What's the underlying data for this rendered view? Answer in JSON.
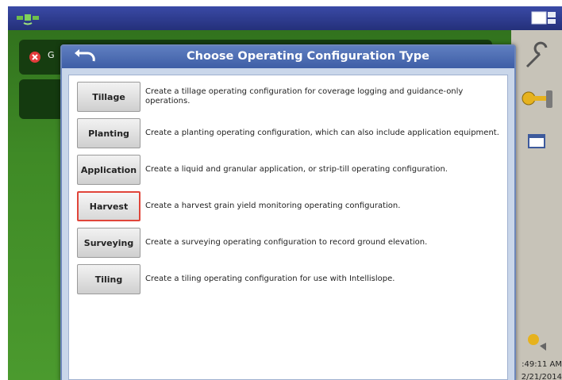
{
  "header": {
    "status_text": "G",
    "icons": {
      "satellite": "satellite-icon",
      "screens": "screens-icon",
      "error": "error-icon"
    }
  },
  "sidebar": {
    "icons": [
      "wrench-icon",
      "key-icon",
      "screen-icon",
      "tools-icon"
    ],
    "time": ":49:11 AM",
    "date": "2/21/2014"
  },
  "dialog": {
    "title": "Choose Operating Configuration Type",
    "back_icon": "back-arrow-icon",
    "selected": "Harvest",
    "options": [
      {
        "label": "Tillage",
        "description": "Create a tillage operating configuration for coverage logging and guidance-only operations."
      },
      {
        "label": "Planting",
        "description": "Create a planting operating configuration, which can also include application equipment."
      },
      {
        "label": "Application",
        "description": "Create a liquid and granular application, or strip-till operating configuration."
      },
      {
        "label": "Harvest",
        "description": "Create a harvest grain yield monitoring operating configuration."
      },
      {
        "label": "Surveying",
        "description": "Create a surveying operating configuration to record ground elevation."
      },
      {
        "label": "Tiling",
        "description": "Create a tiling operating configuration for use with Intellislope."
      }
    ]
  },
  "colors": {
    "title_bar": "#3e5ea6",
    "selected_border": "#e0453a",
    "background_green": "#3f8a26",
    "top_bar": "#24307a"
  }
}
